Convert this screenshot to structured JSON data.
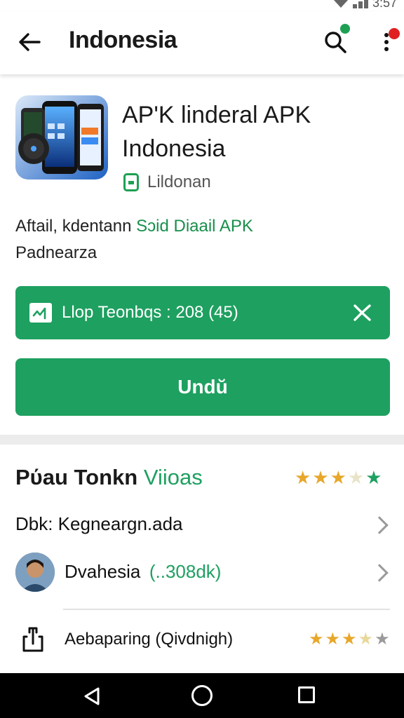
{
  "status_bar": {
    "time": "3:57"
  },
  "app_bar": {
    "title": "Indonesia",
    "icons": [
      "back-arrow-icon",
      "search-icon",
      "more-vert-icon"
    ]
  },
  "app": {
    "name": "AP'K linderal APK Indonesia",
    "developer": "Lildonan",
    "description_prefix": "Aftail, kdentann",
    "description_highlight": "Sɔid Diaail APK",
    "description_line2": "Padnearza"
  },
  "buttons": {
    "info_label": "Llop Teonbqs : 208 (45)",
    "download_label": "Undŭ"
  },
  "reviews": {
    "title_dark": "Pύau Tonkn",
    "title_green": "Viioas",
    "rating_stars": 3.5,
    "rows": [
      {
        "label": "Dbk: Keɡneargn.ada"
      },
      {
        "label": "Dvahesia",
        "badge": "(..308dk)"
      },
      {
        "label": "Aebaparing (Qivdnigh)",
        "rating_stars": 3.5
      }
    ]
  },
  "colors": {
    "accent": "#1ea060",
    "star": "#e8a72a",
    "notif_green": "#1ea053",
    "notif_red": "#e02020"
  }
}
